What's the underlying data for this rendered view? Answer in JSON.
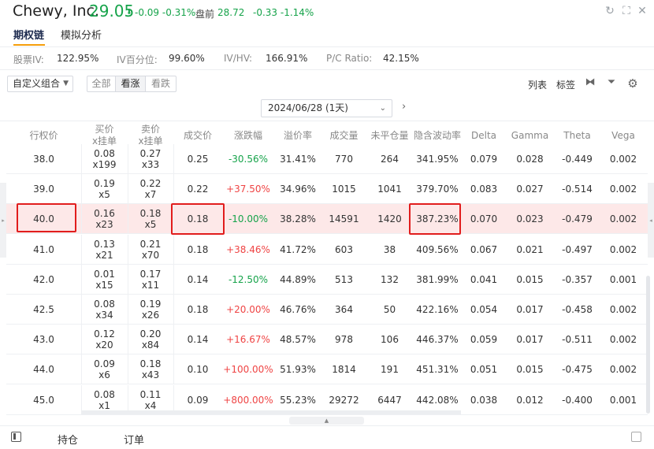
{
  "header": {
    "name": "Chewy, Inc.",
    "price": "29.05",
    "change": "-0.09 -0.31%",
    "premarket_label": "盘前",
    "premarket_price": "28.72",
    "premarket_change": "-0.33 -1.14%",
    "colors": {
      "down": "#16a34a",
      "up": "#ef4444",
      "accent": "#f59e0b",
      "highlight_row": "#fde8e8",
      "annotation_box": "#e11d1d"
    }
  },
  "tabs": [
    {
      "label": "期权链"
    },
    {
      "label": "模拟分析"
    }
  ],
  "stats": [
    {
      "label": "股票IV:",
      "value": "122.95%"
    },
    {
      "label": "IV百分位:",
      "value": "99.60%"
    },
    {
      "label": "IV/HV:",
      "value": "166.91%"
    },
    {
      "label": "P/C Ratio:",
      "value": "42.15%"
    }
  ],
  "toolbar": {
    "combo_label": "自定义组合",
    "segments": [
      {
        "label": "全部"
      },
      {
        "label": "看涨"
      },
      {
        "label": "看跌"
      }
    ],
    "active_segment": "看涨",
    "list_label": "列表",
    "tag_label": "标签"
  },
  "date": {
    "selected": "2024/06/28 (1天)"
  },
  "columns": [
    {
      "label": "行权价"
    },
    {
      "label": "买价\nx挂单"
    },
    {
      "label": "卖价\nx挂单"
    },
    {
      "label": "成交价"
    },
    {
      "label": "涨跌幅"
    },
    {
      "label": "溢价率"
    },
    {
      "label": "成交量"
    },
    {
      "label": "未平仓量"
    },
    {
      "label": "隐含波动率"
    },
    {
      "label": "Delta"
    },
    {
      "label": "Gamma"
    },
    {
      "label": "Theta"
    },
    {
      "label": "Vega"
    }
  ],
  "rows": [
    {
      "strike": "38.0",
      "bid": "0.08",
      "bid_size": "x199",
      "ask": "0.27",
      "ask_size": "x33",
      "last": "0.25",
      "change": "-30.56%",
      "premium": "31.41%",
      "volume": "770",
      "oi": "264",
      "iv": "341.95%",
      "delta": "0.079",
      "gamma": "0.028",
      "theta": "-0.449",
      "vega": "0.002"
    },
    {
      "strike": "39.0",
      "bid": "0.19",
      "bid_size": "x5",
      "ask": "0.22",
      "ask_size": "x7",
      "last": "0.22",
      "change": "+37.50%",
      "premium": "34.96%",
      "volume": "1015",
      "oi": "1041",
      "iv": "379.70%",
      "delta": "0.083",
      "gamma": "0.027",
      "theta": "-0.514",
      "vega": "0.002"
    },
    {
      "strike": "40.0",
      "bid": "0.16",
      "bid_size": "x23",
      "ask": "0.18",
      "ask_size": "x5",
      "last": "0.18",
      "change": "-10.00%",
      "premium": "38.28%",
      "volume": "14591",
      "oi": "1420",
      "iv": "387.23%",
      "delta": "0.070",
      "gamma": "0.023",
      "theta": "-0.479",
      "vega": "0.002"
    },
    {
      "strike": "41.0",
      "bid": "0.13",
      "bid_size": "x21",
      "ask": "0.21",
      "ask_size": "x70",
      "last": "0.18",
      "change": "+38.46%",
      "premium": "41.72%",
      "volume": "603",
      "oi": "38",
      "iv": "409.56%",
      "delta": "0.067",
      "gamma": "0.021",
      "theta": "-0.497",
      "vega": "0.002"
    },
    {
      "strike": "42.0",
      "bid": "0.01",
      "bid_size": "x15",
      "ask": "0.17",
      "ask_size": "x11",
      "last": "0.14",
      "change": "-12.50%",
      "premium": "44.89%",
      "volume": "513",
      "oi": "132",
      "iv": "381.99%",
      "delta": "0.041",
      "gamma": "0.015",
      "theta": "-0.357",
      "vega": "0.001"
    },
    {
      "strike": "42.5",
      "bid": "0.08",
      "bid_size": "x34",
      "ask": "0.19",
      "ask_size": "x26",
      "last": "0.18",
      "change": "+20.00%",
      "premium": "46.76%",
      "volume": "364",
      "oi": "50",
      "iv": "422.16%",
      "delta": "0.054",
      "gamma": "0.017",
      "theta": "-0.458",
      "vega": "0.002"
    },
    {
      "strike": "43.0",
      "bid": "0.12",
      "bid_size": "x20",
      "ask": "0.20",
      "ask_size": "x84",
      "last": "0.14",
      "change": "+16.67%",
      "premium": "48.57%",
      "volume": "978",
      "oi": "106",
      "iv": "446.37%",
      "delta": "0.059",
      "gamma": "0.017",
      "theta": "-0.511",
      "vega": "0.002"
    },
    {
      "strike": "44.0",
      "bid": "0.09",
      "bid_size": "x6",
      "ask": "0.18",
      "ask_size": "x43",
      "last": "0.10",
      "change": "+100.00%",
      "premium": "51.93%",
      "volume": "1814",
      "oi": "191",
      "iv": "451.31%",
      "delta": "0.051",
      "gamma": "0.015",
      "theta": "-0.475",
      "vega": "0.002"
    },
    {
      "strike": "45.0",
      "bid": "0.08",
      "bid_size": "x1",
      "ask": "0.11",
      "ask_size": "x4",
      "last": "0.09",
      "change": "+800.00%",
      "premium": "55.23%",
      "volume": "29272",
      "oi": "6447",
      "iv": "442.08%",
      "delta": "0.038",
      "gamma": "0.012",
      "theta": "-0.400",
      "vega": "0.001"
    }
  ],
  "footer": {
    "tabs": [
      {
        "label": "持仓"
      },
      {
        "label": "订单"
      }
    ]
  },
  "icons": [
    "refresh-icon",
    "expand-icon",
    "close-icon",
    "column-adjust-icon",
    "filter-icon",
    "settings-icon",
    "panel-toggle-icon",
    "popout-icon"
  ]
}
